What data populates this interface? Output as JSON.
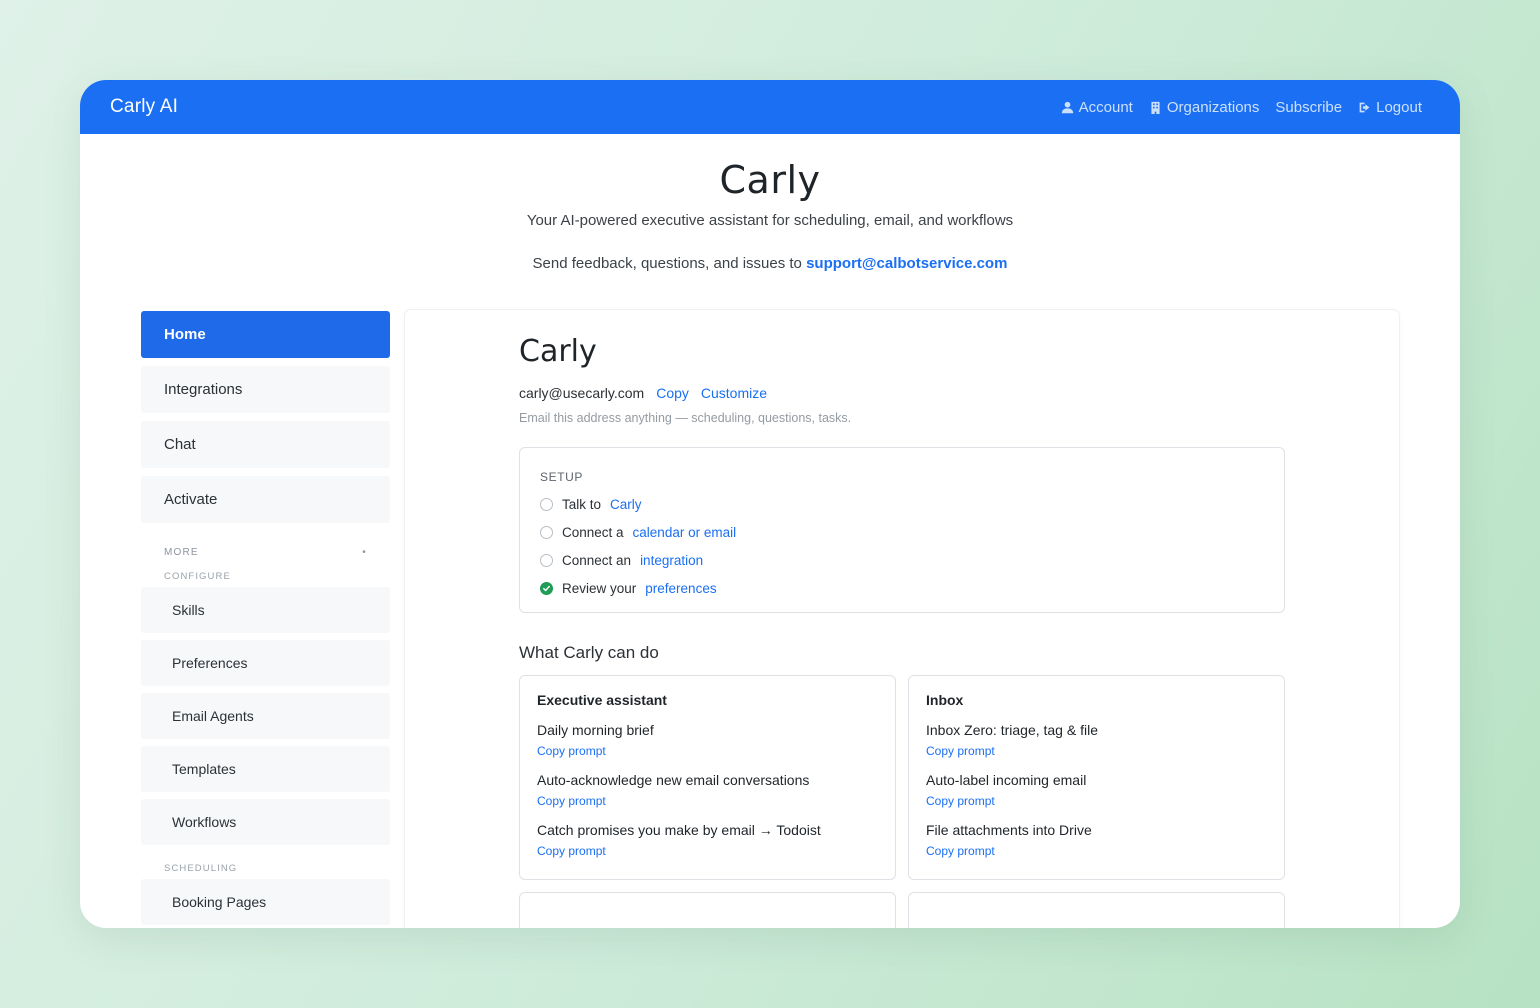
{
  "navbar": {
    "brand": "Carly AI",
    "links": [
      {
        "label": "Account",
        "icon": "user-icon"
      },
      {
        "label": "Organizations",
        "icon": "building-icon"
      },
      {
        "label": "Subscribe",
        "icon": ""
      },
      {
        "label": "Logout",
        "icon": "logout-icon"
      }
    ]
  },
  "hero": {
    "title": "Carly",
    "subtitle": "Your AI-powered executive assistant for scheduling, email, and workflows",
    "feedback_text": "Send feedback, questions, and issues to",
    "feedback_email": "support@calbotservice.com"
  },
  "sidebar": {
    "primary": [
      {
        "label": "Home",
        "active": true
      },
      {
        "label": "Integrations"
      },
      {
        "label": "Chat"
      },
      {
        "label": "Activate"
      }
    ],
    "more_heading": "MORE",
    "more_toggle": "•",
    "configure_heading": "CONFIGURE",
    "configure_items": [
      "Skills",
      "Preferences",
      "Email Agents",
      "Templates",
      "Workflows"
    ],
    "scheduling_heading": "SCHEDULING",
    "scheduling_items": [
      "Booking Pages"
    ]
  },
  "main": {
    "title": "Carly",
    "email": "carly@usecarly.com",
    "copy_label": "Copy",
    "customize_label": "Customize",
    "hint": "Email this address anything — scheduling, questions, tasks.",
    "setup": {
      "label": "SETUP",
      "items": [
        {
          "text": "Talk to",
          "link": "Carly",
          "done": false
        },
        {
          "text": "Connect a",
          "link": "calendar or email",
          "done": false
        },
        {
          "text": "Connect an",
          "link": "integration",
          "done": false
        },
        {
          "text": "Review your",
          "link": "preferences",
          "done": true
        }
      ]
    },
    "capabilities_title": "What Carly can do",
    "capabilities": [
      {
        "heading": "Executive assistant",
        "items": [
          {
            "title": "Daily morning brief",
            "action": "Copy prompt"
          },
          {
            "title": "Auto-acknowledge new email conversations",
            "action": "Copy prompt"
          },
          {
            "title": "Catch promises you make by email → Todoist",
            "action": "Copy prompt"
          }
        ]
      },
      {
        "heading": "Inbox",
        "items": [
          {
            "title": "Inbox Zero: triage, tag & file",
            "action": "Copy prompt"
          },
          {
            "title": "Auto-label incoming email",
            "action": "Copy prompt"
          },
          {
            "title": "File attachments into Drive",
            "action": "Copy prompt"
          }
        ]
      }
    ]
  },
  "colors": {
    "primary": "#1a6ff3",
    "success": "#1f9d55"
  }
}
